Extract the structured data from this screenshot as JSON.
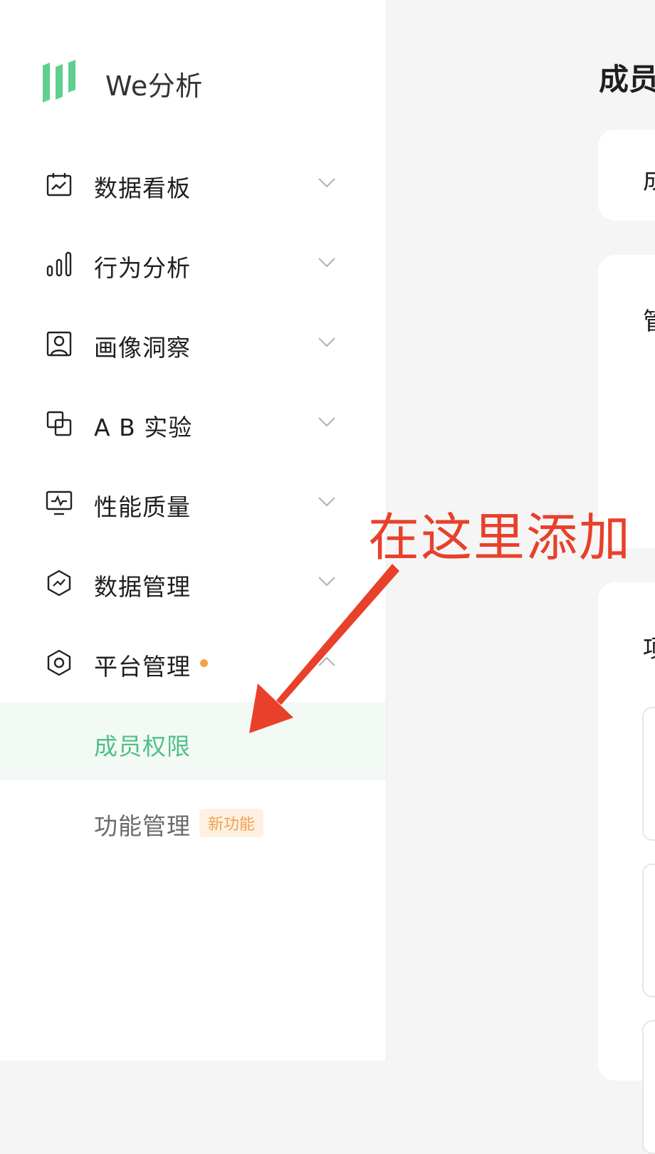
{
  "app": {
    "name": "We分析"
  },
  "sidebar": {
    "items": [
      {
        "label": "数据看板",
        "icon": "dashboard-icon"
      },
      {
        "label": "行为分析",
        "icon": "bar-chart-icon"
      },
      {
        "label": "画像洞察",
        "icon": "portrait-icon"
      },
      {
        "label": "A B 实验",
        "icon": "ab-test-icon"
      },
      {
        "label": "性能质量",
        "icon": "monitor-icon"
      },
      {
        "label": "数据管理",
        "icon": "data-hexagon-icon"
      },
      {
        "label": "平台管理",
        "icon": "settings-hexagon-icon",
        "has_dot": true
      }
    ],
    "sub_items": [
      {
        "label": "成员权限",
        "active": true
      },
      {
        "label": "功能管理",
        "badge": "新功能"
      }
    ]
  },
  "main": {
    "title": "成员",
    "card1_text": "成",
    "card2_text": "管",
    "card3_text": "项"
  },
  "annotation": {
    "text": "在这里添加",
    "color": "#e8402a"
  },
  "colors": {
    "accent": "#4fc187",
    "badge_text": "#f2a14a",
    "dot": "#f5a348"
  }
}
